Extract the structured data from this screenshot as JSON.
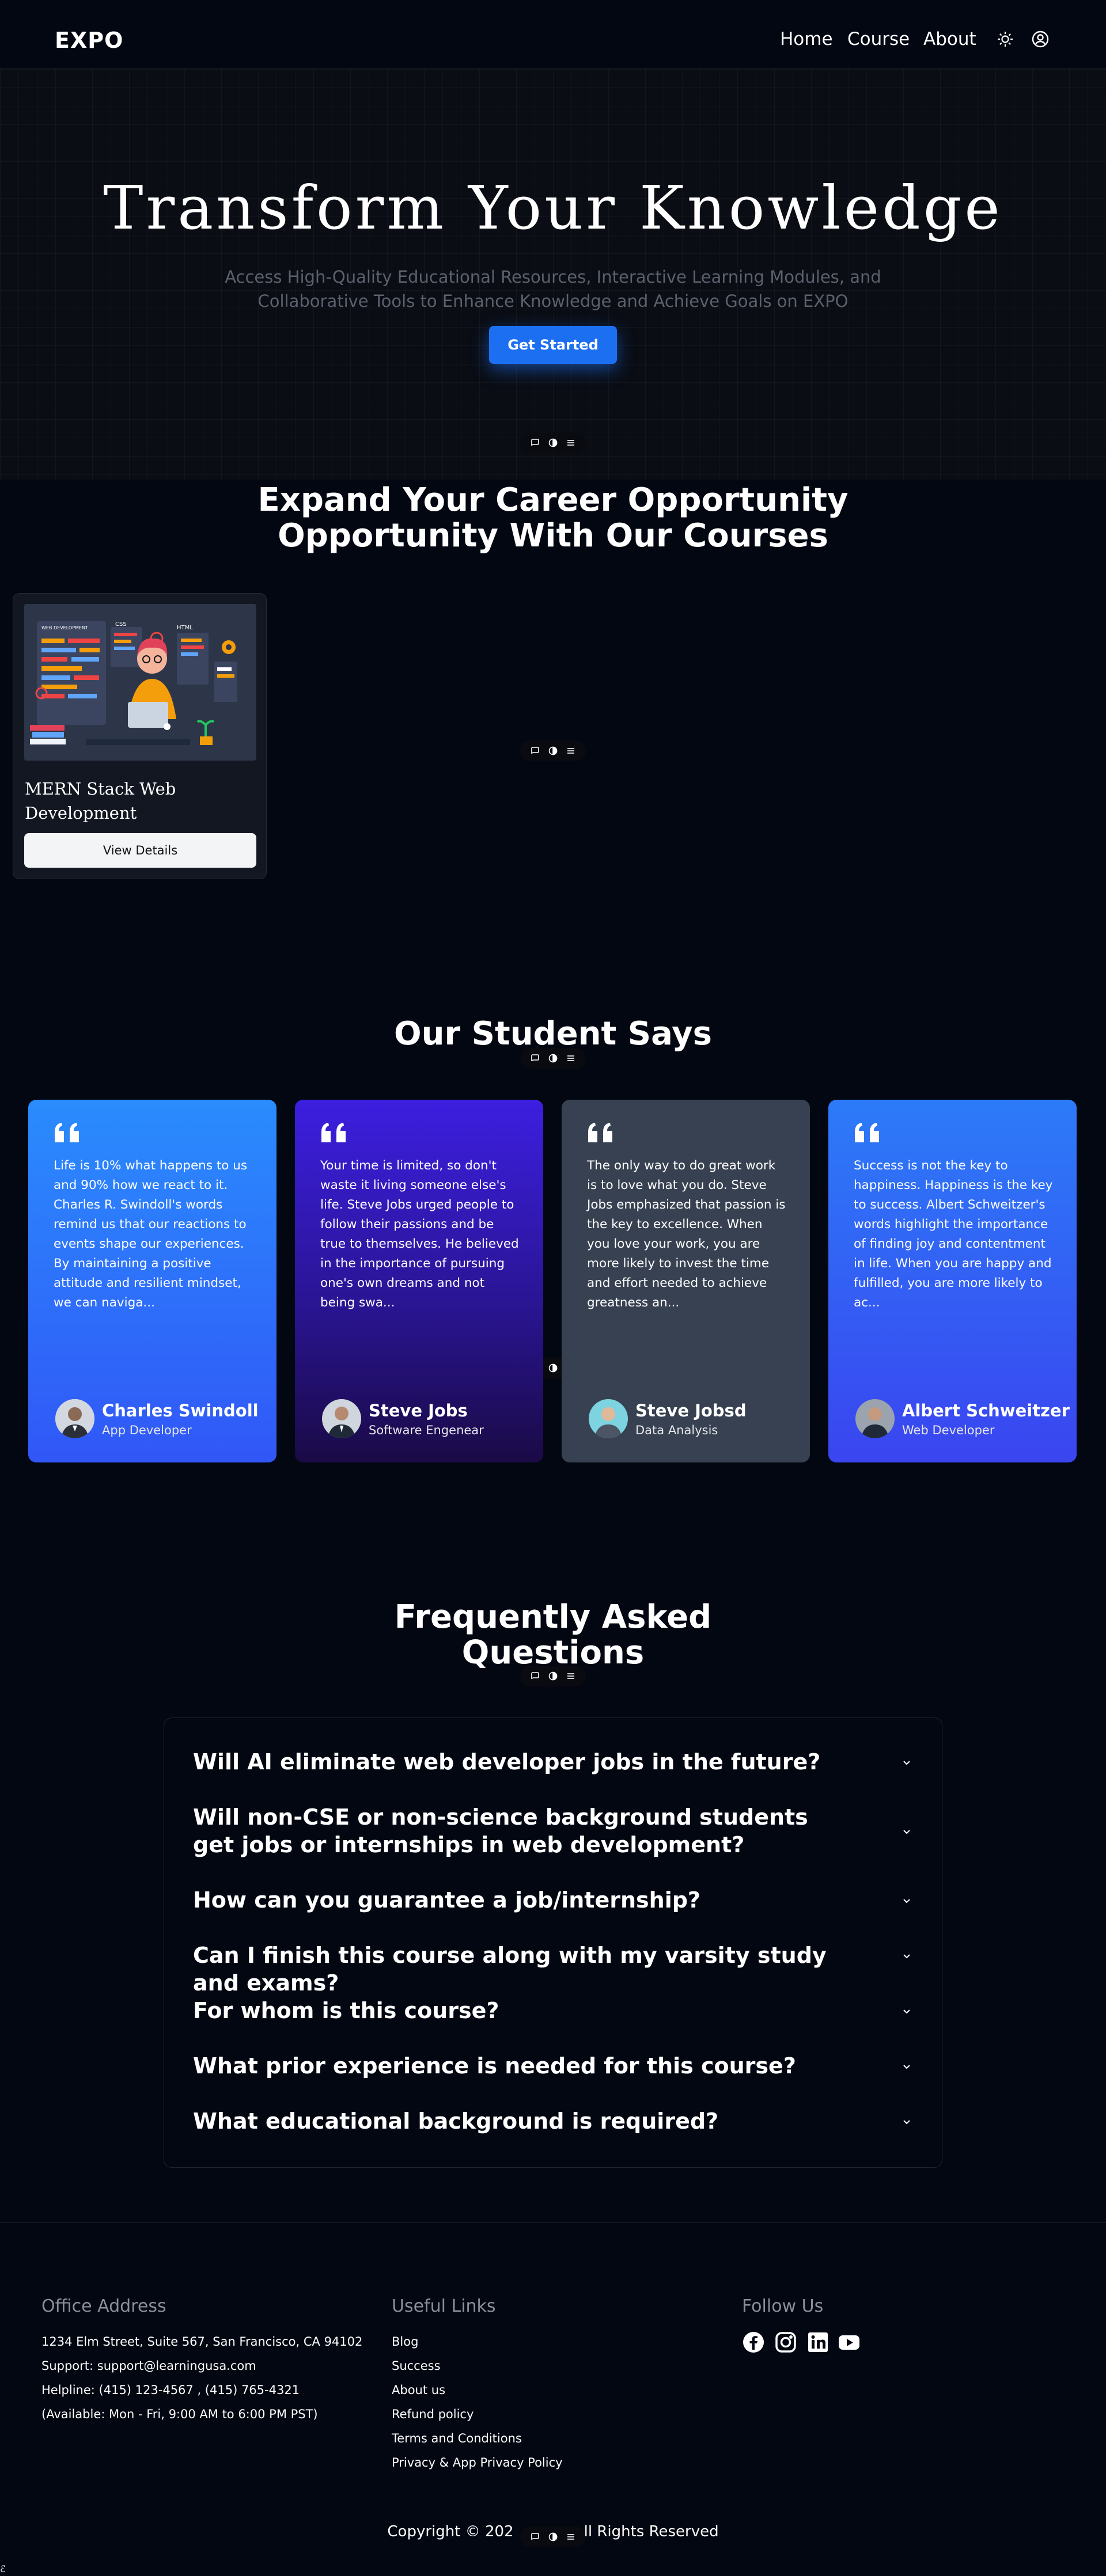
{
  "nav": {
    "logo": "EXPO",
    "links": [
      "Home",
      "Course",
      "About"
    ],
    "theme_icon": "sun-icon",
    "profile_icon": "user-circle-icon"
  },
  "hero": {
    "title": "Transform Your Knowledge",
    "subtitle": "Access High-Quality Educational Resources, Interactive Learning Modules, and Collaborative Tools to Enhance Knowledge and Achieve Goals on EXPO",
    "cta": "Get Started"
  },
  "courses": {
    "title_line1": "Expand Your Career Opportunity",
    "title_line2": "Opportunity With Our Courses",
    "items": [
      {
        "title": "MERN Stack Web Development",
        "button": "View Details",
        "image_labels": [
          "WEB DEVELOPMENT",
          "CSS",
          "HTML"
        ]
      }
    ]
  },
  "testimonials": {
    "title": "Our Student Says",
    "items": [
      {
        "text": "Life is 10% what happens to us and 90% how we react to it. Charles R. Swindoll's words remind us that our reactions to events shape our experiences. By maintaining a positive attitude and resilient mindset, we can naviga...",
        "name": "Charles Swindoll",
        "role": "App Developer"
      },
      {
        "text": "Your time is limited, so don't waste it living someone else's life. Steve Jobs urged people to follow their passions and be true to themselves. He believed in the importance of pursuing one's own dreams and not being swa...",
        "name": "Steve Jobs",
        "role": "Software Engenear"
      },
      {
        "text": "The only way to do great work is to love what you do. Steve Jobs emphasized that passion is the key to excellence. When you love your work, you are more likely to invest the time and effort needed to achieve greatness an...",
        "name": "Steve Jobsd",
        "role": "Data Analysis"
      },
      {
        "text": "Success is not the key to happiness. Happiness is the key to success. Albert Schweitzer's words highlight the importance of finding joy and contentment in life. When you are happy and fulfilled, you are more likely to ac...",
        "name": "Albert Schweitzer",
        "role": "Web Developer"
      }
    ]
  },
  "faq": {
    "title_line1": "Frequently Asked",
    "title_line2": "Questions",
    "items": [
      "Will AI eliminate web developer jobs in the future?",
      "Will non-CSE or non-science background students get jobs or internships in web development?",
      "How can you guarantee a job/internship?",
      "Can I finish this course along with my varsity study and exams?",
      "For whom is this course?",
      "What prior experience is needed for this course?",
      "What educational background is required?"
    ]
  },
  "footer": {
    "office": {
      "heading": "Office Address",
      "lines": [
        "1234 Elm Street, Suite 567, San Francisco, CA 94102",
        "Support: support@learningusa.com",
        "Helpline: (415) 123-4567 , (415) 765-4321",
        "(Available: Mon - Fri, 9:00 AM to 6:00 PM PST)"
      ]
    },
    "links": {
      "heading": "Useful Links",
      "items": [
        "Blog",
        "Success",
        "About us",
        "Refund policy",
        "Terms and Conditions",
        "Privacy & App Privacy Policy"
      ]
    },
    "follow": {
      "heading": "Follow Us",
      "icons": [
        "facebook-icon",
        "instagram-icon",
        "linkedin-icon",
        "youtube-icon"
      ]
    },
    "copyright_left": "Copyright © 202",
    "copyright_right": "ll Rights Reserved",
    "corner_mark": "ℰ"
  },
  "colors": {
    "background": "#030712",
    "accent": "#1d6ff2",
    "card1": "#2a8cfd",
    "card2": "#3c1fe0",
    "card3": "#374151",
    "card4": "#2c7bf8"
  }
}
